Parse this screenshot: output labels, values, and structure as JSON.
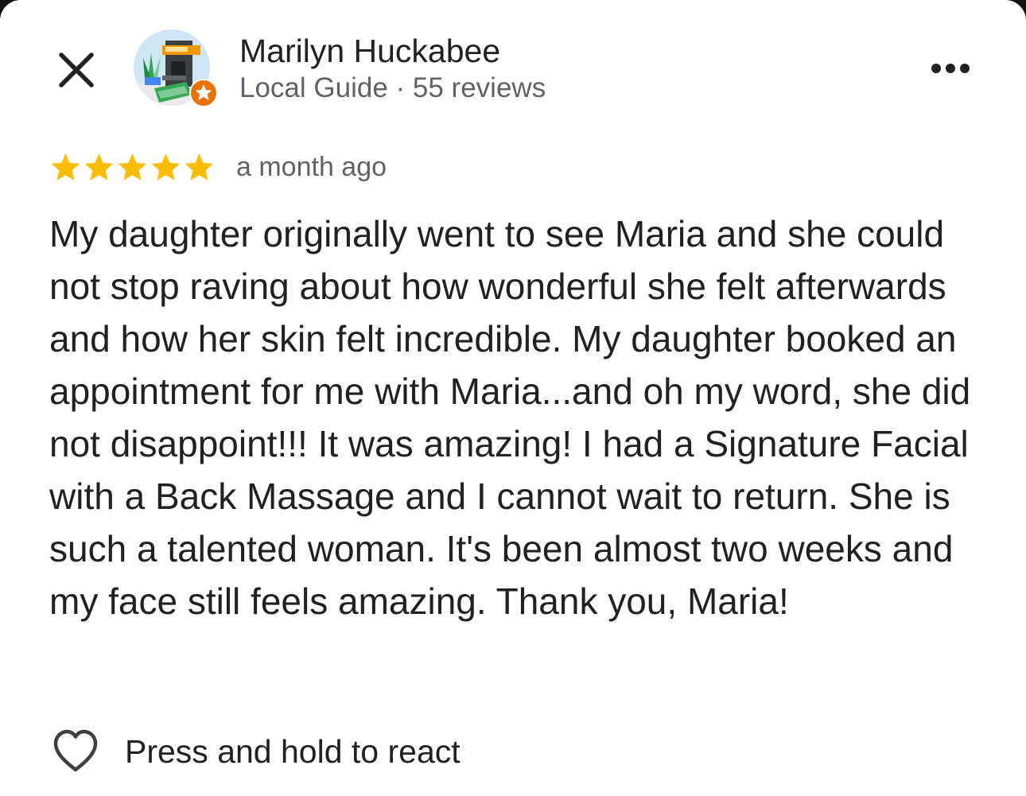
{
  "reviewer": {
    "name": "Marilyn Huckabee",
    "meta": "Local Guide · 55 reviews"
  },
  "review": {
    "rating": 5,
    "rating_max": 5,
    "date": "a month ago",
    "text": "My daughter originally went to see Maria and she could not stop raving about how wonderful she felt afterwards and how her skin felt incredible. My daughter booked an appointment for me with Maria...and oh my word, she did not disappoint!!! It was amazing! I had a Signature Facial with a Back Massage and I cannot wait to return. She is such a talented woman. It's been almost two weeks and my face still feels amazing. Thank you, Maria!"
  },
  "actions": {
    "react_label": "Press and hold to react"
  },
  "icons": {
    "close": "close-icon",
    "more": "more-horizontal-icon",
    "star": "star-icon",
    "heart": "heart-outline-icon",
    "badge": "local-guide-star-badge-icon"
  },
  "colors": {
    "star": "#FBBC04",
    "badge": "#E8710A",
    "text_primary": "#202124",
    "text_secondary": "#5F6368"
  }
}
